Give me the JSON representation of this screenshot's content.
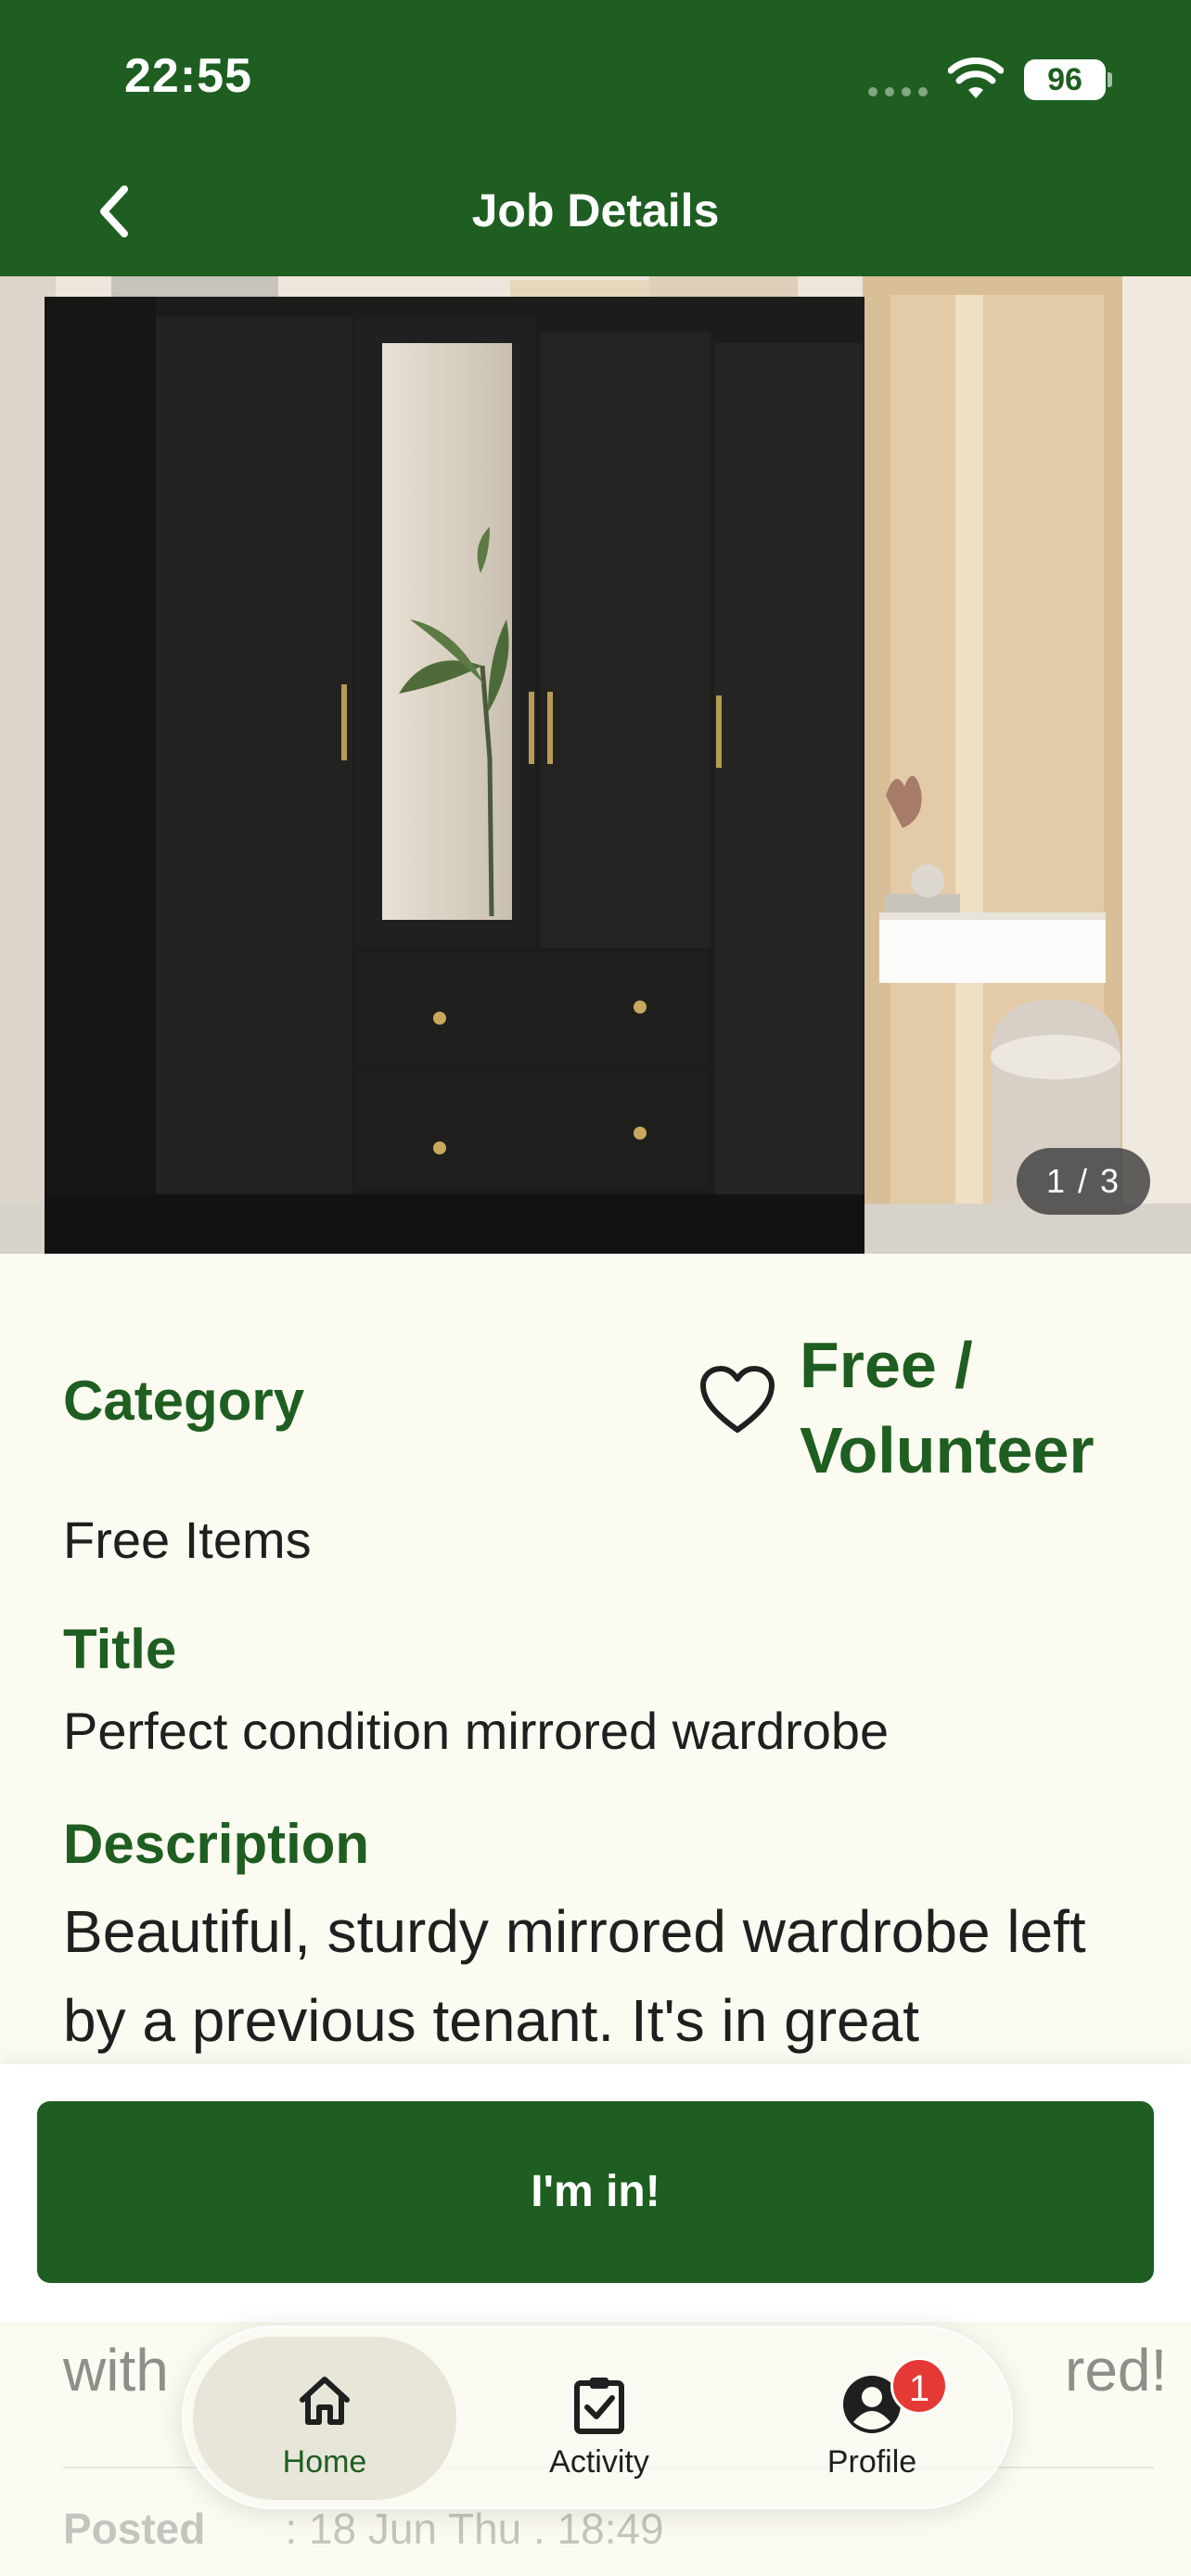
{
  "status_bar": {
    "time": "22:55",
    "battery": "96"
  },
  "header": {
    "title": "Job Details",
    "back_icon": "chevron-left-icon"
  },
  "gallery": {
    "pager": "1 / 3"
  },
  "details": {
    "category_label": "Category",
    "category_value": "Free Items",
    "price": "Free / Volunteer",
    "title_label": "Title",
    "title_value": "Perfect condition mirrored wardrobe",
    "description_label": "Description",
    "description_visible": "Beautiful, sturdy mirrored wardrobe left by a previous tenant. It's in great",
    "description_partial": "with",
    "description_partial_end": "red!",
    "posted_label": "Posted",
    "posted_value": ": 18 Jun Thu . 18:49"
  },
  "action": {
    "button_label": "I'm in!"
  },
  "nav": {
    "items": [
      {
        "label": "Home",
        "icon": "home-icon",
        "active": true
      },
      {
        "label": "Activity",
        "icon": "clipboard-check-icon",
        "active": false
      },
      {
        "label": "Profile",
        "icon": "user-circle-icon",
        "active": false,
        "badge": "1"
      }
    ]
  },
  "colors": {
    "brand": "#1e5e21",
    "background": "#fcfbf1",
    "badge": "#e53935"
  }
}
